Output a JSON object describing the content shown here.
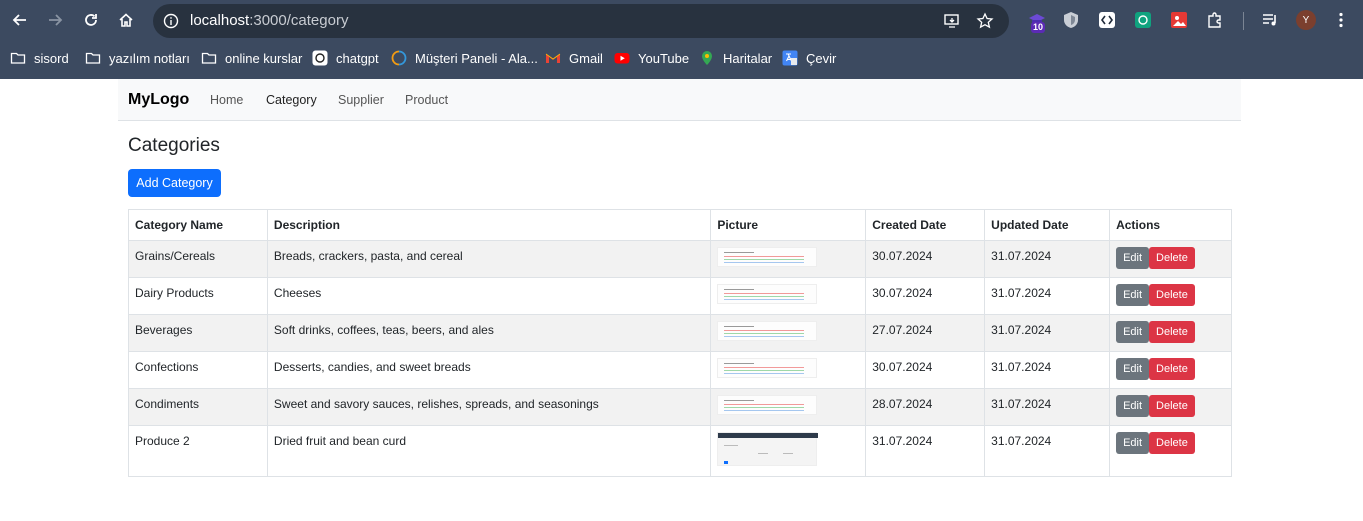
{
  "browser": {
    "url_host": "localhost",
    "url_path": ":3000/category",
    "profile_initial": "Y",
    "extension_badge": "10",
    "bookmarks": [
      {
        "label": "sisord",
        "icon": "folder-icon"
      },
      {
        "label": "yazılım notları",
        "icon": "folder-icon"
      },
      {
        "label": "online kurslar",
        "icon": "folder-icon"
      },
      {
        "label": "chatgpt",
        "icon": "chatgpt-icon"
      },
      {
        "label": "Müşteri Paneli - Ala...",
        "icon": "circle-logo-icon"
      },
      {
        "label": "Gmail",
        "icon": "gmail-icon"
      },
      {
        "label": "YouTube",
        "icon": "youtube-icon"
      },
      {
        "label": "Haritalar",
        "icon": "maps-icon"
      },
      {
        "label": "Çevir",
        "icon": "translate-icon"
      }
    ]
  },
  "navbar": {
    "brand": "MyLogo",
    "links": [
      "Home",
      "Category",
      "Supplier",
      "Product"
    ]
  },
  "page": {
    "title": "Categories",
    "add_button": "Add Category"
  },
  "table": {
    "headers": [
      "Category Name",
      "Description",
      "Picture",
      "Created Date",
      "Updated Date",
      "Actions"
    ],
    "rows": [
      {
        "name": "Grains/Cereals",
        "description": "Breads, crackers, pasta, and cereal",
        "created": "30.07.2024",
        "updated": "31.07.2024"
      },
      {
        "name": "Dairy Products",
        "description": "Cheeses",
        "created": "30.07.2024",
        "updated": "31.07.2024"
      },
      {
        "name": "Beverages",
        "description": "Soft drinks, coffees, teas, beers, and ales",
        "created": "27.07.2024",
        "updated": "31.07.2024"
      },
      {
        "name": "Confections",
        "description": "Desserts, candies, and sweet breads",
        "created": "30.07.2024",
        "updated": "31.07.2024"
      },
      {
        "name": "Condiments",
        "description": "Sweet and savory sauces, relishes, spreads, and seasonings",
        "created": "28.07.2024",
        "updated": "31.07.2024"
      },
      {
        "name": "Produce 2",
        "description": "Dried fruit and bean curd",
        "created": "31.07.2024",
        "updated": "31.07.2024"
      }
    ],
    "edit_label": "Edit",
    "delete_label": "Delete"
  },
  "colors": {
    "chrome_bg": "#3c4a60",
    "primary": "#0d6efd",
    "secondary": "#6c757d",
    "danger": "#dc3545"
  }
}
